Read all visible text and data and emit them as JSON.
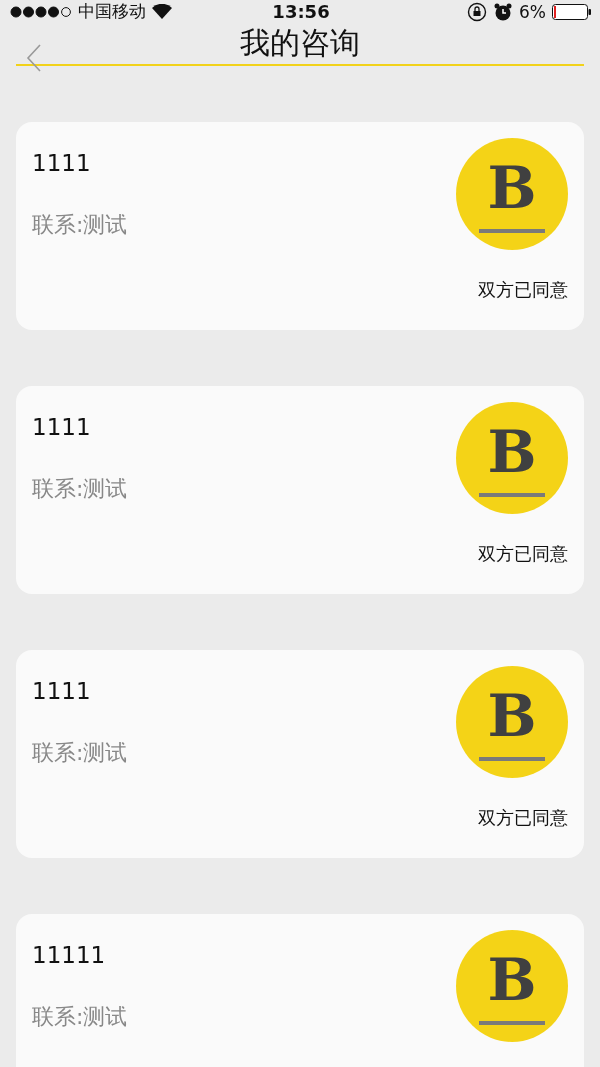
{
  "status_bar": {
    "carrier": "中国移动",
    "time": "13:56",
    "battery": "6%"
  },
  "nav": {
    "title": "我的咨询"
  },
  "consultations": [
    {
      "title": "1111",
      "contact": "联系:测试",
      "logo": "B",
      "status": "双方已同意"
    },
    {
      "title": "1111",
      "contact": "联系:测试",
      "logo": "B",
      "status": "双方已同意"
    },
    {
      "title": "1111",
      "contact": "联系:测试",
      "logo": "B",
      "status": "双方已同意"
    },
    {
      "title": "11111",
      "contact": "联系:测试",
      "logo": "B"
    }
  ]
}
